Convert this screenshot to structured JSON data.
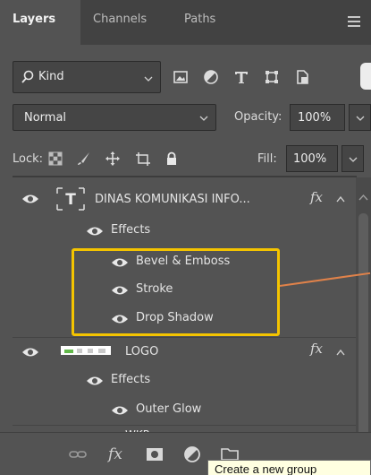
{
  "tabs": [
    {
      "label": "Layers",
      "active": true
    },
    {
      "label": "Channels",
      "active": false
    },
    {
      "label": "Paths",
      "active": false
    }
  ],
  "filter": {
    "kind_label": "Kind",
    "icons": [
      "image-filter-icon",
      "adjustment-filter-icon",
      "type-filter-icon",
      "shape-filter-icon",
      "smart-object-filter-icon"
    ]
  },
  "blend": {
    "mode": "Normal",
    "opacity_label": "Opacity:",
    "opacity_value": "100%"
  },
  "lock": {
    "label": "Lock:",
    "fill_label": "Fill:",
    "fill_value": "100%"
  },
  "layers": [
    {
      "name": "DINAS KOMUNIKASI INFO...",
      "type": "text",
      "fx": "fx"
    },
    {
      "name": "Effects"
    },
    {
      "name": "Bevel & Emboss"
    },
    {
      "name": "Stroke"
    },
    {
      "name": "Drop Shadow"
    },
    {
      "name": "LOGO",
      "type": "image",
      "fx": "fx"
    },
    {
      "name": "Effects"
    },
    {
      "name": "Outer Glow"
    },
    {
      "name": "WKP",
      "type": "image"
    }
  ],
  "text_thumb_glyph": "T",
  "bottom_icons": [
    "link-icon",
    "fx",
    "mask-icon",
    "adjustment-icon",
    "group-icon",
    "new-layer-icon",
    "trash-icon"
  ],
  "bottom_fx_label": "fx",
  "tooltip": "Create a new group",
  "colors": {
    "panel_bg": "#535353",
    "tab_bar_bg": "#424242",
    "highlight": "#f4c400",
    "callout_line": "#e0824a"
  }
}
